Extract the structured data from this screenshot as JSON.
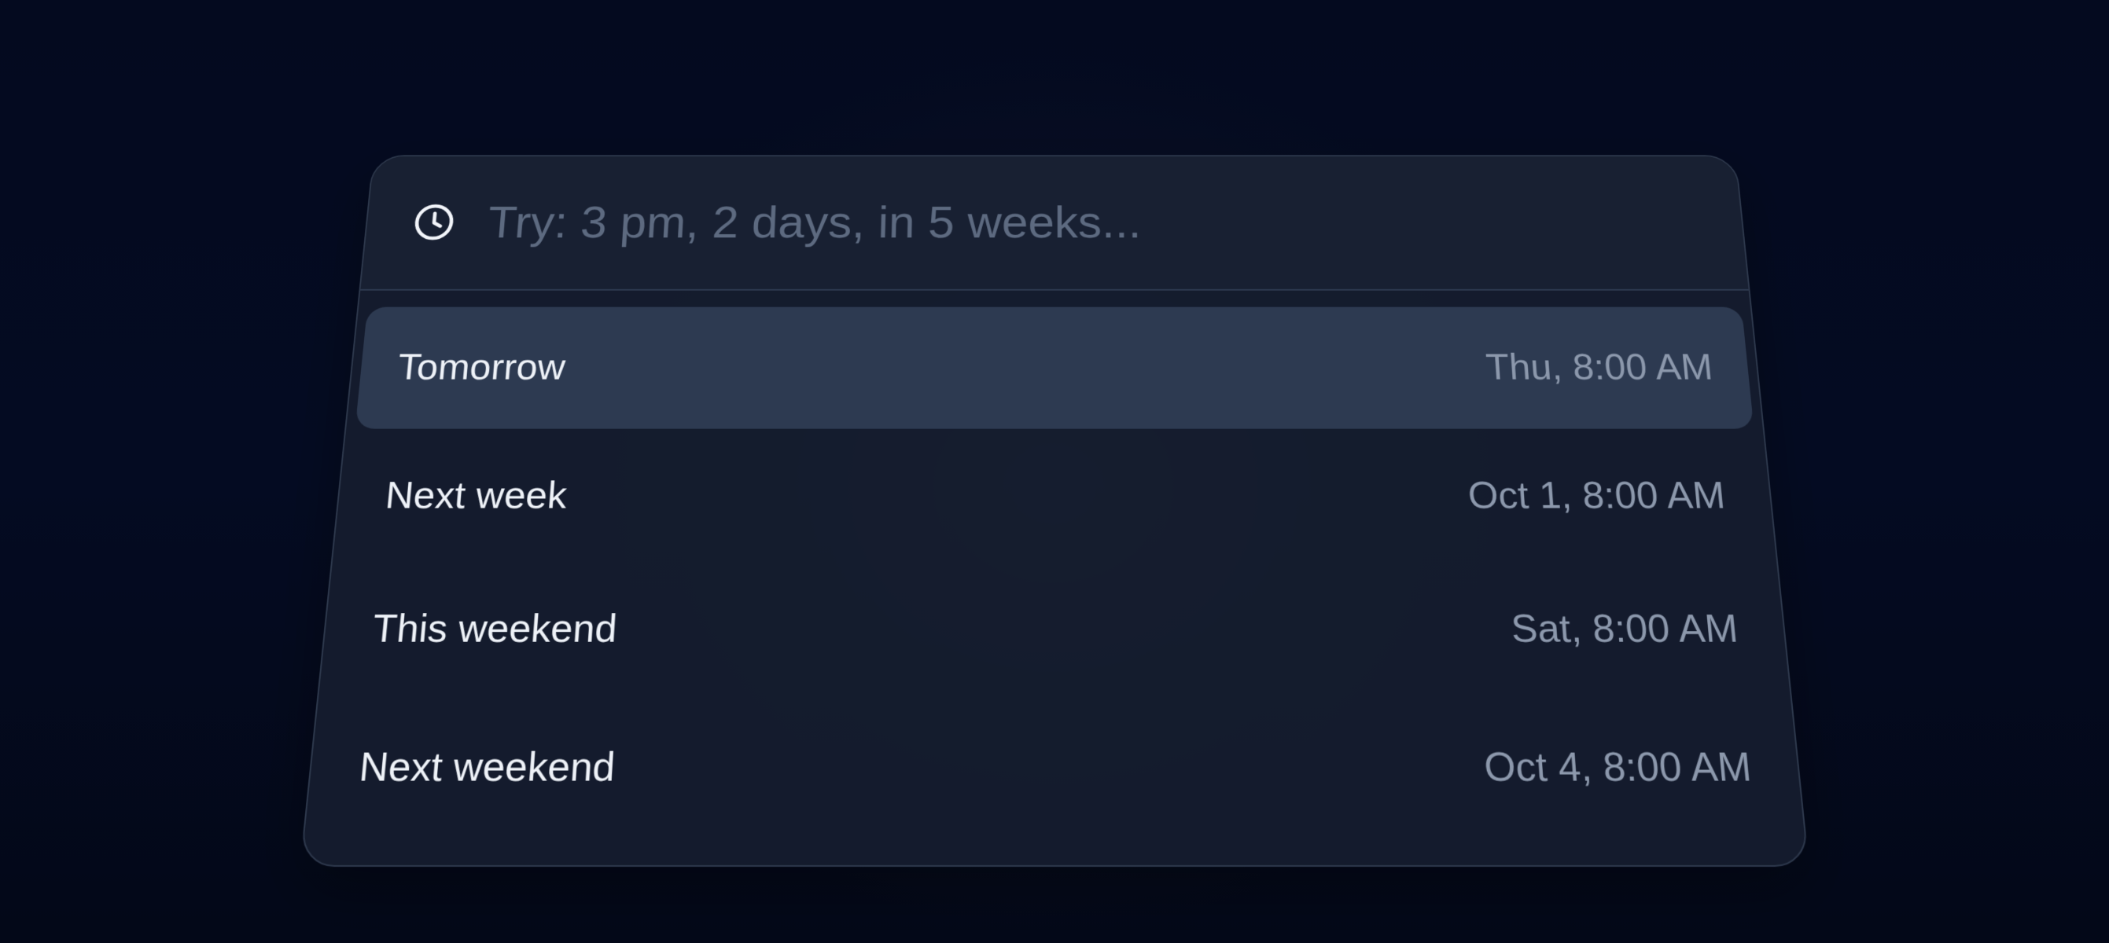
{
  "search": {
    "placeholder": "Try: 3 pm, 2 days, in 5 weeks...",
    "value": "",
    "icon": "clock-icon"
  },
  "options": [
    {
      "label": "Tomorrow",
      "time": "Thu, 8:00 AM",
      "selected": true
    },
    {
      "label": "Next week",
      "time": "Oct 1, 8:00 AM",
      "selected": false
    },
    {
      "label": "This weekend",
      "time": "Sat, 8:00 AM",
      "selected": false
    },
    {
      "label": "Next weekend",
      "time": "Oct 4, 8:00 AM",
      "selected": false
    }
  ],
  "colors": {
    "background": "#040a1f",
    "panel": "#151c2e",
    "selected_row": "#2d3a51",
    "label_text": "#eef2f8",
    "time_text": "#8c98ac",
    "placeholder_text": "#5d6a80"
  }
}
